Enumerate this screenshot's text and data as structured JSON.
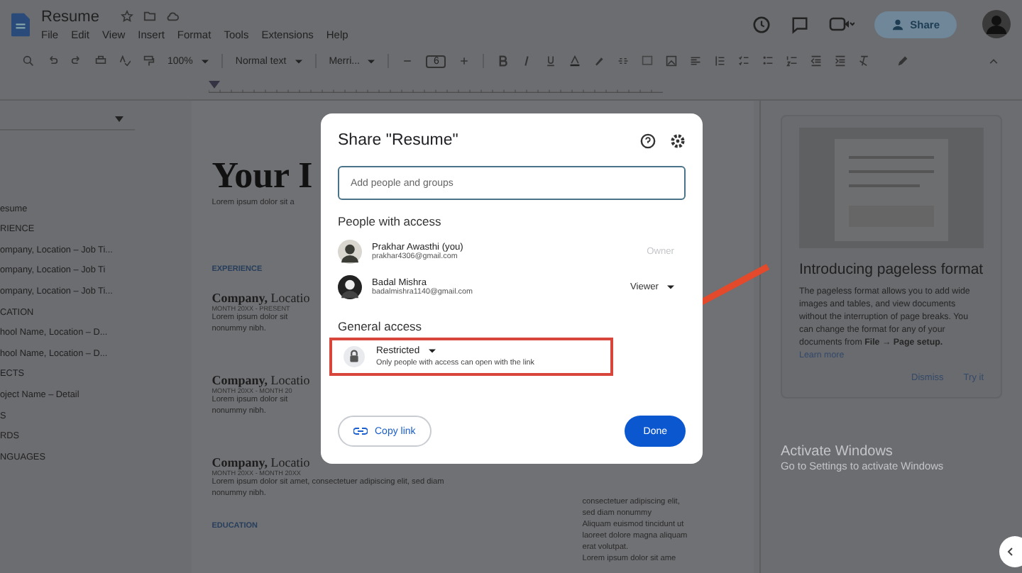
{
  "app": {
    "doc_title": "Resume",
    "menu": [
      "File",
      "Edit",
      "View",
      "Insert",
      "Format",
      "Tools",
      "Extensions",
      "Help"
    ],
    "toolbar": {
      "zoom": "100%",
      "style": "Normal text",
      "font": "Merri...",
      "font_size": "6"
    },
    "share_button": "Share"
  },
  "outline": {
    "items": [
      {
        "text": "esume"
      },
      {
        "text": "RIENCE"
      },
      {
        "text": "ompany, Location – Job Ti..."
      },
      {
        "text": "ompany, Location – Job Ti"
      },
      {
        "text": "ompany, Location – Job Ti..."
      },
      {
        "text": "CATION"
      },
      {
        "text": "hool Name, Location – D..."
      },
      {
        "text": "hool Name, Location – D..."
      },
      {
        "text": "ECTS"
      },
      {
        "text": "oject Name – Detail"
      },
      {
        "text": "S"
      },
      {
        "text": "RDS"
      },
      {
        "text": "NGUAGES"
      }
    ]
  },
  "document": {
    "heading": "Your I",
    "subtitle": "Lorem ipsum dolor sit a",
    "section": "EXPERIENCE",
    "jobs": [
      {
        "company": "Company,",
        "location": "Locatio",
        "dates": "MONTH 20XX - PRESENT",
        "lines": [
          "Lorem ipsum dolor sit",
          "nonummy nibh."
        ]
      },
      {
        "company": "Company,",
        "location": "Locatio",
        "dates": "MONTH 20XX - MONTH 20",
        "lines": [
          "Lorem ipsum dolor sit",
          "nonummy nibh."
        ]
      },
      {
        "company": "Company,",
        "location": "Locatio",
        "dates": "MONTH 20XX - MONTH 20XX",
        "lines": [
          "Lorem ipsum dolor sit amet, consectetuer adipiscing elit, sed diam",
          "nonummy nibh."
        ]
      }
    ],
    "section_2": "EDUCATION",
    "side_lines": [
      "consectetuer adipiscing elit,",
      "sed diam nonummy",
      "Aliquam euismod tincidunt ut",
      "laoreet dolore magna aliquam",
      "erat volutpat.",
      "Lorem ipsum dolor sit ame"
    ]
  },
  "tip": {
    "title": "Introducing pageless format",
    "body": "The pageless format allows you to add wide images and tables, and view documents without the interruption of page breaks. You can change the format for any of your documents from **File → Page setup.**",
    "link": "Learn more",
    "buttons": [
      "Dismiss",
      "Try it"
    ]
  },
  "activation": {
    "title": "Activate Windows",
    "subtitle": "Go to Settings to activate Windows"
  },
  "dialog": {
    "title": "Share \"Resume\"",
    "input": {
      "placeholder": "Add people and groups"
    },
    "people_heading": "People with access",
    "people": [
      {
        "name": "Prakhar Awasthi (you)",
        "email": "prakhar4306@gmail.com",
        "role": "Owner",
        "editable": false
      },
      {
        "name": "Badal Mishra",
        "email": "badalmishra1140@gmail.com",
        "role": "Viewer",
        "editable": true
      }
    ],
    "general_heading": "General access",
    "access": {
      "label": "Restricted",
      "description": "Only people with access can open with the link",
      "highlighted": true
    },
    "copy_link": "Copy link",
    "done": "Done"
  }
}
